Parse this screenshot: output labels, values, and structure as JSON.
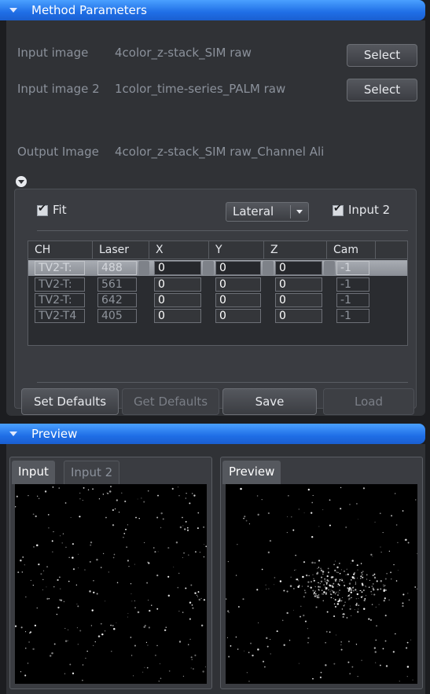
{
  "method_parameters": {
    "title": "Method Parameters",
    "input_image": {
      "label": "Input image",
      "value": "4color_z-stack_SIM raw",
      "button": "Select"
    },
    "input_image_2": {
      "label": "Input image 2",
      "value": "1color_time-series_PALM raw",
      "button": "Select"
    },
    "output_image": {
      "label": "Output Image",
      "value": "4color_z-stack_SIM raw_Channel Ali"
    },
    "fit_label": "Fit",
    "fit_checked": true,
    "mode_dropdown": "Lateral",
    "input2_label": "Input 2",
    "input2_checked": true,
    "table": {
      "headers": [
        "CH",
        "Laser",
        "X",
        "Y",
        "Z",
        "Cam"
      ],
      "rows": [
        {
          "ch": "TV2-T:",
          "laser": "488",
          "x": "0",
          "y": "0",
          "z": "0",
          "cam": "-1"
        },
        {
          "ch": "TV2-T:",
          "laser": "561",
          "x": "0",
          "y": "0",
          "z": "0",
          "cam": "-1"
        },
        {
          "ch": "TV2-T:",
          "laser": "642",
          "x": "0",
          "y": "0",
          "z": "0",
          "cam": "-1"
        },
        {
          "ch": "TV2-T4",
          "laser": "405",
          "x": "0",
          "y": "0",
          "z": "0",
          "cam": "-1"
        }
      ]
    },
    "buttons": {
      "set_defaults": "Set Defaults",
      "get_defaults": "Get Defaults",
      "save": "Save",
      "load": "Load"
    }
  },
  "preview": {
    "title": "Preview",
    "left_tabs": [
      "Input",
      "Input 2"
    ],
    "right_tabs": [
      "Preview"
    ]
  },
  "colors": {
    "header_blue": "#1f6ee6",
    "panel_bg": "#303236"
  }
}
